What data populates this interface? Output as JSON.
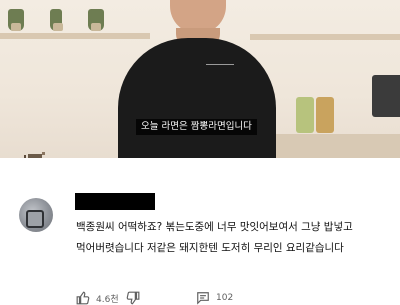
{
  "video": {
    "subtitle": "오늘 라면은 짬뽕라면입니다"
  },
  "comment": {
    "text": "백종원씨 어떡하죠? 볶는도중에 너무 맛잇어보여서 그냥 밥넣고 먹어버렷습니다 저같은 돼지한텐 도저히 무리인 요리같습니다",
    "like_count": "4.6천",
    "reply_count": "102"
  },
  "icons": [
    "thumbs-up-icon",
    "thumbs-down-icon",
    "reply-icon"
  ]
}
